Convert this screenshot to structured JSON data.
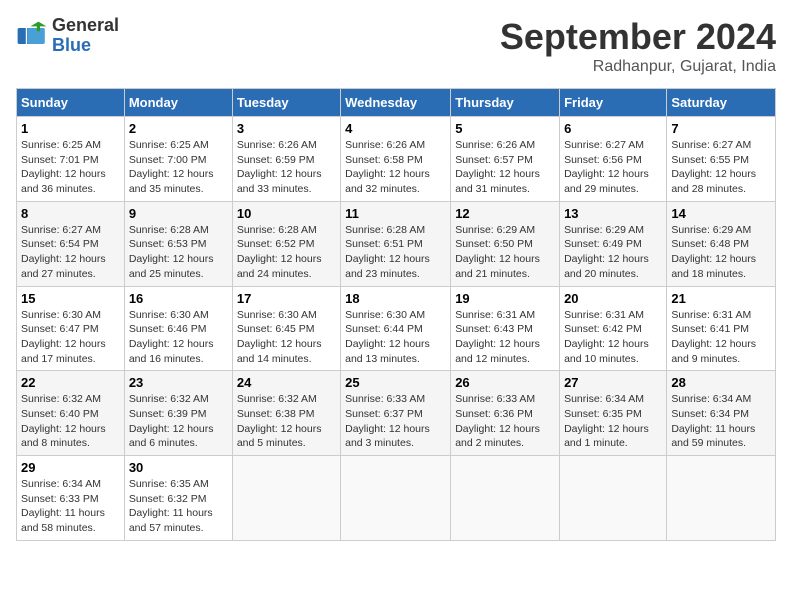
{
  "logo": {
    "general": "General",
    "blue": "Blue"
  },
  "title": "September 2024",
  "location": "Radhanpur, Gujarat, India",
  "headers": [
    "Sunday",
    "Monday",
    "Tuesday",
    "Wednesday",
    "Thursday",
    "Friday",
    "Saturday"
  ],
  "weeks": [
    [
      {
        "day": "1",
        "sunrise": "6:25 AM",
        "sunset": "7:01 PM",
        "daylight": "12 hours and 36 minutes."
      },
      {
        "day": "2",
        "sunrise": "6:25 AM",
        "sunset": "7:00 PM",
        "daylight": "12 hours and 35 minutes."
      },
      {
        "day": "3",
        "sunrise": "6:26 AM",
        "sunset": "6:59 PM",
        "daylight": "12 hours and 33 minutes."
      },
      {
        "day": "4",
        "sunrise": "6:26 AM",
        "sunset": "6:58 PM",
        "daylight": "12 hours and 32 minutes."
      },
      {
        "day": "5",
        "sunrise": "6:26 AM",
        "sunset": "6:57 PM",
        "daylight": "12 hours and 31 minutes."
      },
      {
        "day": "6",
        "sunrise": "6:27 AM",
        "sunset": "6:56 PM",
        "daylight": "12 hours and 29 minutes."
      },
      {
        "day": "7",
        "sunrise": "6:27 AM",
        "sunset": "6:55 PM",
        "daylight": "12 hours and 28 minutes."
      }
    ],
    [
      {
        "day": "8",
        "sunrise": "6:27 AM",
        "sunset": "6:54 PM",
        "daylight": "12 hours and 27 minutes."
      },
      {
        "day": "9",
        "sunrise": "6:28 AM",
        "sunset": "6:53 PM",
        "daylight": "12 hours and 25 minutes."
      },
      {
        "day": "10",
        "sunrise": "6:28 AM",
        "sunset": "6:52 PM",
        "daylight": "12 hours and 24 minutes."
      },
      {
        "day": "11",
        "sunrise": "6:28 AM",
        "sunset": "6:51 PM",
        "daylight": "12 hours and 23 minutes."
      },
      {
        "day": "12",
        "sunrise": "6:29 AM",
        "sunset": "6:50 PM",
        "daylight": "12 hours and 21 minutes."
      },
      {
        "day": "13",
        "sunrise": "6:29 AM",
        "sunset": "6:49 PM",
        "daylight": "12 hours and 20 minutes."
      },
      {
        "day": "14",
        "sunrise": "6:29 AM",
        "sunset": "6:48 PM",
        "daylight": "12 hours and 18 minutes."
      }
    ],
    [
      {
        "day": "15",
        "sunrise": "6:30 AM",
        "sunset": "6:47 PM",
        "daylight": "12 hours and 17 minutes."
      },
      {
        "day": "16",
        "sunrise": "6:30 AM",
        "sunset": "6:46 PM",
        "daylight": "12 hours and 16 minutes."
      },
      {
        "day": "17",
        "sunrise": "6:30 AM",
        "sunset": "6:45 PM",
        "daylight": "12 hours and 14 minutes."
      },
      {
        "day": "18",
        "sunrise": "6:30 AM",
        "sunset": "6:44 PM",
        "daylight": "12 hours and 13 minutes."
      },
      {
        "day": "19",
        "sunrise": "6:31 AM",
        "sunset": "6:43 PM",
        "daylight": "12 hours and 12 minutes."
      },
      {
        "day": "20",
        "sunrise": "6:31 AM",
        "sunset": "6:42 PM",
        "daylight": "12 hours and 10 minutes."
      },
      {
        "day": "21",
        "sunrise": "6:31 AM",
        "sunset": "6:41 PM",
        "daylight": "12 hours and 9 minutes."
      }
    ],
    [
      {
        "day": "22",
        "sunrise": "6:32 AM",
        "sunset": "6:40 PM",
        "daylight": "12 hours and 8 minutes."
      },
      {
        "day": "23",
        "sunrise": "6:32 AM",
        "sunset": "6:39 PM",
        "daylight": "12 hours and 6 minutes."
      },
      {
        "day": "24",
        "sunrise": "6:32 AM",
        "sunset": "6:38 PM",
        "daylight": "12 hours and 5 minutes."
      },
      {
        "day": "25",
        "sunrise": "6:33 AM",
        "sunset": "6:37 PM",
        "daylight": "12 hours and 3 minutes."
      },
      {
        "day": "26",
        "sunrise": "6:33 AM",
        "sunset": "6:36 PM",
        "daylight": "12 hours and 2 minutes."
      },
      {
        "day": "27",
        "sunrise": "6:34 AM",
        "sunset": "6:35 PM",
        "daylight": "12 hours and 1 minute."
      },
      {
        "day": "28",
        "sunrise": "6:34 AM",
        "sunset": "6:34 PM",
        "daylight": "11 hours and 59 minutes."
      }
    ],
    [
      {
        "day": "29",
        "sunrise": "6:34 AM",
        "sunset": "6:33 PM",
        "daylight": "11 hours and 58 minutes."
      },
      {
        "day": "30",
        "sunrise": "6:35 AM",
        "sunset": "6:32 PM",
        "daylight": "11 hours and 57 minutes."
      },
      null,
      null,
      null,
      null,
      null
    ]
  ],
  "labels": {
    "sunrise": "Sunrise:",
    "sunset": "Sunset:",
    "daylight": "Daylight:"
  }
}
